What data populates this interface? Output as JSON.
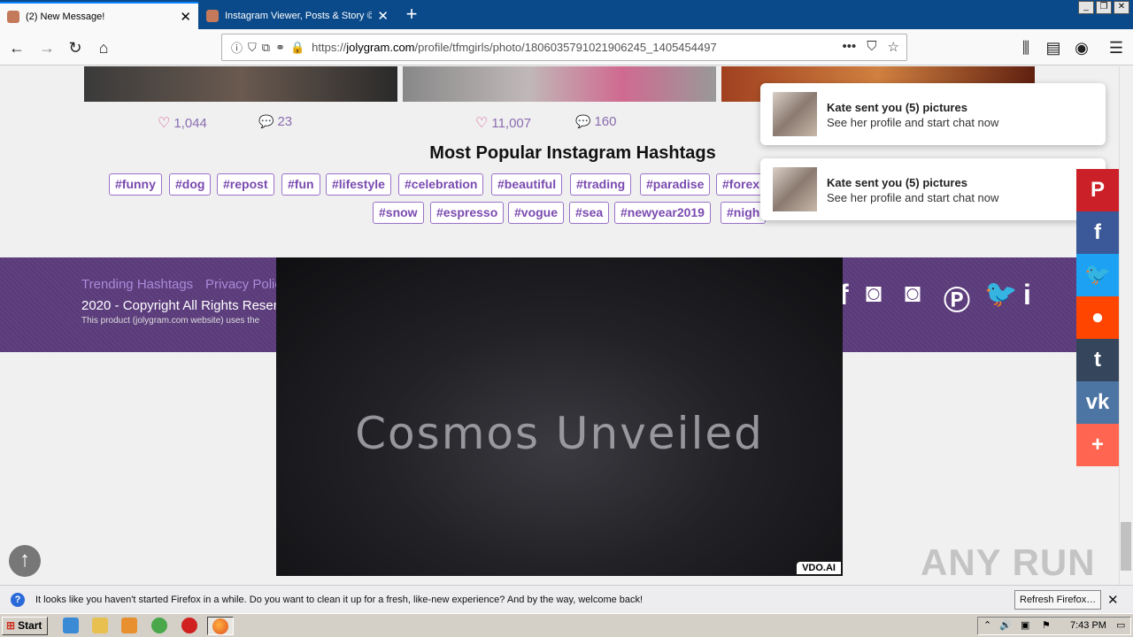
{
  "browser": {
    "tabs": [
      {
        "label": "(2) New Message!",
        "active": true
      },
      {
        "label": "Instagram Viewer, Posts & Story ©",
        "active": false
      }
    ],
    "url_prefix": "https://",
    "url_domain": "jolygram.com",
    "url_path": "/profile/tfmgirls/photo/1806035791021906245_1405454497"
  },
  "posts": [
    {
      "likes": "1,044",
      "comments": "23"
    },
    {
      "likes": "11,007",
      "comments": "160"
    }
  ],
  "hashtags_title": "Most Popular Instagram Hashtags",
  "hashtags_row1": [
    "#funny",
    "#dog",
    "#repost",
    "#fun",
    "#lifestyle",
    "#celebration",
    "#beautiful",
    "#trading",
    "#paradise",
    "#forex"
  ],
  "hashtags_row2": [
    "#snow",
    "#espresso",
    "#vogue",
    "#sea",
    "#newyear2019",
    "#nigh"
  ],
  "footer": {
    "links": [
      "Trending Hashtags",
      "Privacy Polic"
    ],
    "copyright": "2020 - Copyright All Rights Reserv",
    "product_note": "This product (jolygram.com website) uses the"
  },
  "video": {
    "title": "Cosmos Unveiled",
    "brand": "VDO.AI"
  },
  "notifications": [
    {
      "title": "Kate sent you (5) pictures",
      "text": "See her profile and start chat now"
    },
    {
      "title": "Kate sent you (5) pictures",
      "text": "See her profile and start chat now"
    }
  ],
  "share_bar": [
    {
      "icon": "pinterest-icon",
      "glyph": "P",
      "color": "#cb2027"
    },
    {
      "icon": "facebook-icon",
      "glyph": "f",
      "color": "#3b5998"
    },
    {
      "icon": "twitter-icon",
      "glyph": "🐦",
      "color": "#1da1f2"
    },
    {
      "icon": "reddit-icon",
      "glyph": "●",
      "color": "#ff4500"
    },
    {
      "icon": "tumblr-icon",
      "glyph": "t",
      "color": "#35465c"
    },
    {
      "icon": "vk-icon",
      "glyph": "vk",
      "color": "#4c75a3"
    },
    {
      "icon": "more-icon",
      "glyph": "+",
      "color": "#ff6550"
    }
  ],
  "firefox_bar": {
    "message": "It looks like you haven't started Firefox in a while. Do you want to clean it up for a fresh, like-new experience? And by the way, welcome back!",
    "button": "Refresh Firefox…"
  },
  "taskbar": {
    "start": "Start",
    "clock": "7:43 PM"
  },
  "watermark": "ANY RUN"
}
